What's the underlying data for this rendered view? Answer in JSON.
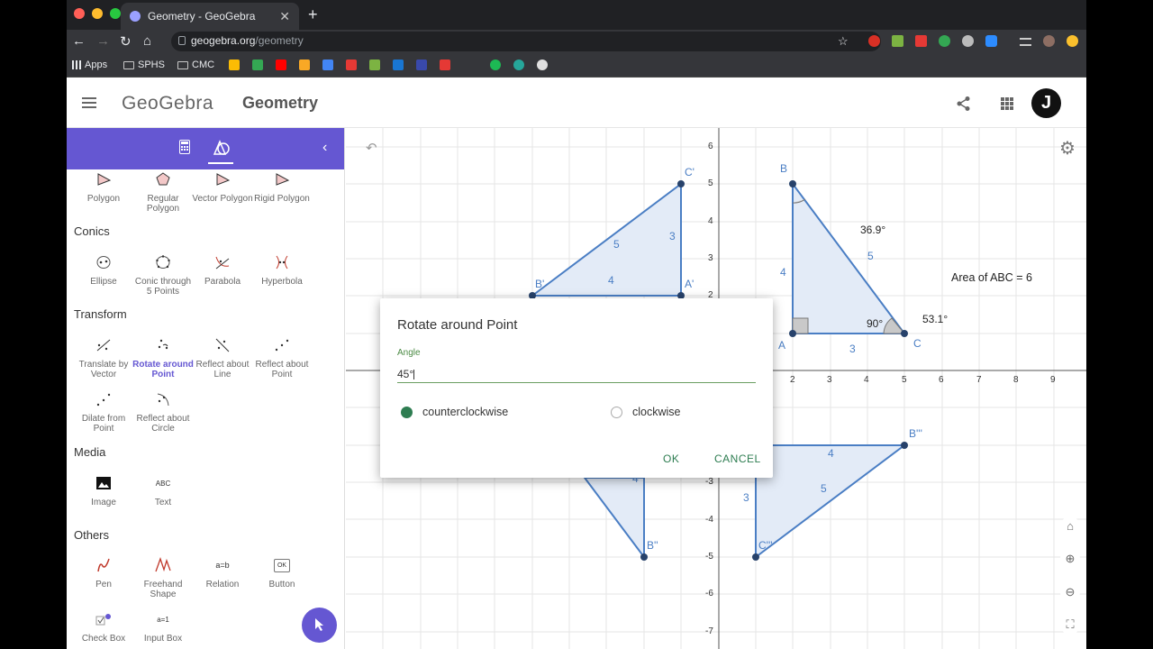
{
  "browser": {
    "tab_title": "Geometry - GeoGebra",
    "url_host": "geogebra.org",
    "url_path": "/geometry",
    "bookmarks": [
      "Apps",
      "SPHS",
      "CMC"
    ]
  },
  "header": {
    "logo": "GeoGebra",
    "title": "Geometry",
    "avatar_letter": "J"
  },
  "sidebar": {
    "categories": {
      "conics": "Conics",
      "transform": "Transform",
      "media": "Media",
      "others": "Others"
    },
    "tools": {
      "polygon": "Polygon",
      "regular_polygon": "Regular Polygon",
      "vector_polygon": "Vector Polygon",
      "rigid_polygon": "Rigid Polygon",
      "ellipse": "Ellipse",
      "conic_5pts": "Conic through 5 Points",
      "parabola": "Parabola",
      "hyperbola": "Hyperbola",
      "translate": "Translate by Vector",
      "rotate": "Rotate around Point",
      "reflect_line": "Reflect about Line",
      "reflect_point": "Reflect about Point",
      "dilate": "Dilate from Point",
      "reflect_circle": "Reflect about Circle",
      "image": "Image",
      "text": "Text",
      "pen": "Pen",
      "freehand": "Freehand Shape",
      "relation": "Relation",
      "button": "Button",
      "checkbox": "Check Box",
      "inputbox": "Input Box"
    },
    "tool_icon_text": {
      "text": "ABC",
      "relation": "a=b",
      "button": "OK",
      "inputbox": "a=1"
    }
  },
  "graph": {
    "x_ticks": [
      "2",
      "3",
      "4",
      "5",
      "6",
      "7",
      "8",
      "9"
    ],
    "y_ticks_pos": [
      "6",
      "5",
      "4",
      "3",
      "2"
    ],
    "y_ticks_neg": [
      "-3",
      "-4",
      "-5",
      "-6",
      "-7"
    ],
    "area_label": "Area of  ABC = 6",
    "points": {
      "A": "A",
      "B": "B",
      "C": "C",
      "A1": "A'",
      "B1": "B'",
      "C1": "C'",
      "B2": "B''",
      "B3": "B'''",
      "C3": "C'''"
    },
    "side_labels": {
      "abc_ab": "4",
      "abc_bc": "5",
      "abc_ac": "3",
      "p1_b1c1": "5",
      "p1_c1a1": "3",
      "p1_a1b1": "4",
      "p3_top": "4",
      "p3_left": "3",
      "p3_hyp": "5",
      "p2_partial": "4"
    },
    "angles": {
      "B": "36.9°",
      "A": "90°",
      "C": "53.1°"
    },
    "colors": {
      "shape_stroke": "#4a7ec4",
      "shape_fill": "#e3ebf7",
      "point": "#27426b"
    }
  },
  "dialog": {
    "title": "Rotate around Point",
    "angle_label": "Angle",
    "angle_value": "45°",
    "option_ccw": "counterclockwise",
    "option_cw": "clockwise",
    "ok": "OK",
    "cancel": "CANCEL"
  }
}
